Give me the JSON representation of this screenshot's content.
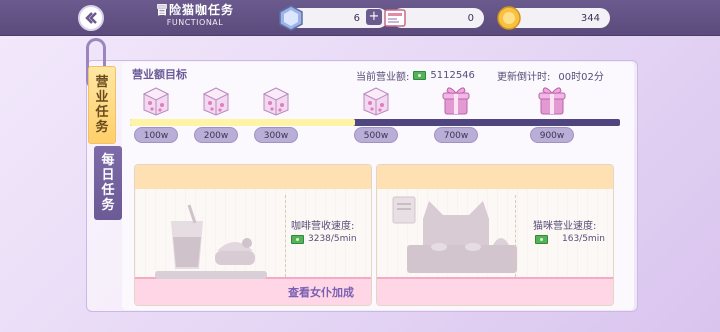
{
  "header": {
    "title": "冒险猫咖任务",
    "subtitle": "FUNCTIONAL"
  },
  "resources": {
    "crystal": {
      "value": "6",
      "icon": "crystal-icon"
    },
    "ticket": {
      "value": "0",
      "icon": "ticket-icon"
    },
    "coin": {
      "value": "344",
      "icon": "coin-icon"
    }
  },
  "tabs": {
    "business": "营业任务",
    "daily": "每日任务"
  },
  "main": {
    "section_title": "营业额目标",
    "revenue_label": "当前营业额:",
    "revenue_value": "5112546",
    "countdown_label": "更新倒计时:",
    "countdown_value": "00时02分",
    "progress_fraction": 0.46
  },
  "milestones": [
    {
      "label": "100w",
      "reward": "gift-box-icon",
      "reached": true
    },
    {
      "label": "200w",
      "reward": "gift-box-icon",
      "reached": true
    },
    {
      "label": "300w",
      "reward": "gift-box-icon",
      "reached": true
    },
    {
      "label": "500w",
      "reward": "gift-box-icon",
      "reached": true
    },
    {
      "label": "700w",
      "reward": "big-gift-icon",
      "reached": false
    },
    {
      "label": "900w",
      "reward": "big-gift-icon",
      "reached": false
    }
  ],
  "cards": {
    "coffee": {
      "speed_label": "咖啡营收速度:",
      "speed_value": "3238/5min"
    },
    "cat": {
      "speed_label": "猫咪营业速度:",
      "speed_value": "163/5min"
    }
  },
  "link_text": "查看女仆加成",
  "colors": {
    "accent": "#6b5a96",
    "track": "#4f4680",
    "track_fill": "#fff3a6",
    "tab_active": "#ffcf6a",
    "money": "#55b25a"
  }
}
